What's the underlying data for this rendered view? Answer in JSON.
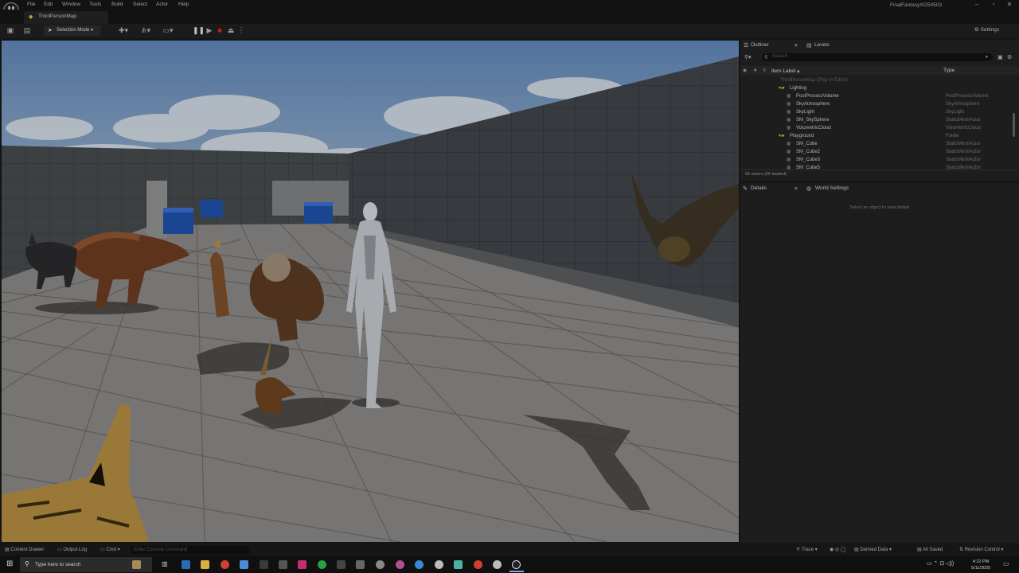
{
  "menu": [
    "File",
    "Edit",
    "Window",
    "Tools",
    "Build",
    "Select",
    "Actor",
    "Help"
  ],
  "project_name": "FinalFantasyXI250503",
  "map_tab": "ThirdPersonMap",
  "toolbar": {
    "selection_mode": "Selection Mode",
    "settings": "Settings"
  },
  "outliner": {
    "tab_outliner": "Outliner",
    "tab_levels": "Levels",
    "search_placeholder": "Search",
    "col_label": "Item Label ▴",
    "col_type": "Type",
    "rows": [
      {
        "label": "ThirdPersonMap (Play In Editor)",
        "type": "",
        "indent": 0,
        "dim": true
      },
      {
        "label": "Lighting",
        "type": "",
        "indent": 1,
        "folder": true
      },
      {
        "label": "PostProcessVolume",
        "type": "PostProcessVolume",
        "indent": 2
      },
      {
        "label": "SkyAtmosphere",
        "type": "SkyAtmosphere",
        "indent": 2
      },
      {
        "label": "SkyLight",
        "type": "SkyLight",
        "indent": 2
      },
      {
        "label": "SM_SkySphere",
        "type": "StaticMeshActor",
        "indent": 2
      },
      {
        "label": "VolumetricCloud",
        "type": "VolumetricCloud",
        "indent": 2
      },
      {
        "label": "Playground",
        "type": "Folder",
        "indent": 1,
        "folder": true
      },
      {
        "label": "SM_Cube",
        "type": "StaticMeshActor",
        "indent": 2
      },
      {
        "label": "SM_Cube2",
        "type": "StaticMeshActor",
        "indent": 2
      },
      {
        "label": "SM_Cube3",
        "type": "StaticMeshActor",
        "indent": 2
      },
      {
        "label": "SM_Cube5",
        "type": "StaticMeshActor",
        "indent": 2
      }
    ],
    "actor_count": "56 actors (56 loaded)"
  },
  "details": {
    "tab_details": "Details",
    "tab_world": "World Settings",
    "empty_message": "Select an object to view details"
  },
  "statusbar": {
    "content_drawer": "Content Drawer",
    "output_log": "Output Log",
    "cmd": "Cmd",
    "console_placeholder": "Enter Console Command",
    "trace": "Trace",
    "derived_data": "Derived Data",
    "all_saved": "All Saved",
    "revision_control": "Revision Control"
  },
  "taskbar": {
    "search_placeholder": "Type here to search",
    "time": "4:22 PM",
    "date": "5/11/2025"
  },
  "colors": {
    "accent_blue": "#1e4fa8",
    "play_stop_red": "#c02020",
    "folder": "#c8a040"
  }
}
